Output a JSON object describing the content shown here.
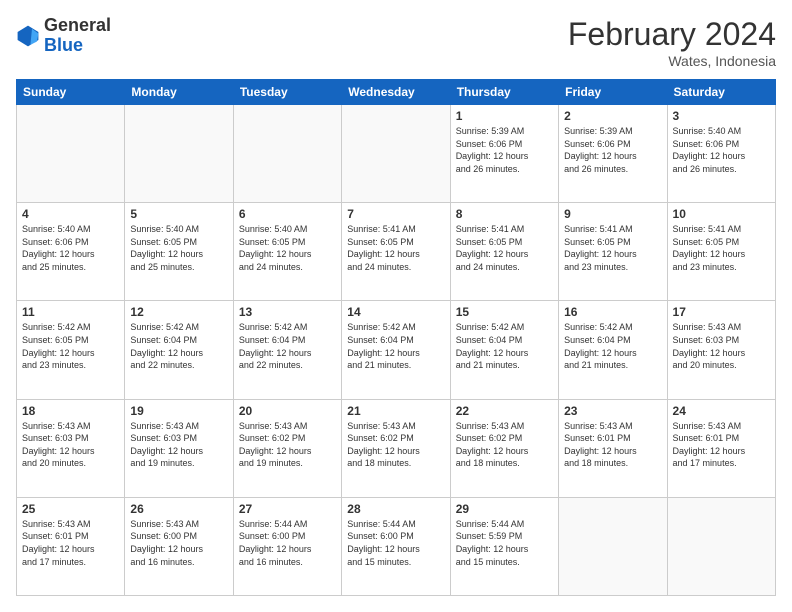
{
  "header": {
    "logo_general": "General",
    "logo_blue": "Blue",
    "month_title": "February 2024",
    "location": "Wates, Indonesia"
  },
  "days_of_week": [
    "Sunday",
    "Monday",
    "Tuesday",
    "Wednesday",
    "Thursday",
    "Friday",
    "Saturday"
  ],
  "weeks": [
    [
      {
        "day": "",
        "info": ""
      },
      {
        "day": "",
        "info": ""
      },
      {
        "day": "",
        "info": ""
      },
      {
        "day": "",
        "info": ""
      },
      {
        "day": "1",
        "info": "Sunrise: 5:39 AM\nSunset: 6:06 PM\nDaylight: 12 hours\nand 26 minutes."
      },
      {
        "day": "2",
        "info": "Sunrise: 5:39 AM\nSunset: 6:06 PM\nDaylight: 12 hours\nand 26 minutes."
      },
      {
        "day": "3",
        "info": "Sunrise: 5:40 AM\nSunset: 6:06 PM\nDaylight: 12 hours\nand 26 minutes."
      }
    ],
    [
      {
        "day": "4",
        "info": "Sunrise: 5:40 AM\nSunset: 6:06 PM\nDaylight: 12 hours\nand 25 minutes."
      },
      {
        "day": "5",
        "info": "Sunrise: 5:40 AM\nSunset: 6:05 PM\nDaylight: 12 hours\nand 25 minutes."
      },
      {
        "day": "6",
        "info": "Sunrise: 5:40 AM\nSunset: 6:05 PM\nDaylight: 12 hours\nand 24 minutes."
      },
      {
        "day": "7",
        "info": "Sunrise: 5:41 AM\nSunset: 6:05 PM\nDaylight: 12 hours\nand 24 minutes."
      },
      {
        "day": "8",
        "info": "Sunrise: 5:41 AM\nSunset: 6:05 PM\nDaylight: 12 hours\nand 24 minutes."
      },
      {
        "day": "9",
        "info": "Sunrise: 5:41 AM\nSunset: 6:05 PM\nDaylight: 12 hours\nand 23 minutes."
      },
      {
        "day": "10",
        "info": "Sunrise: 5:41 AM\nSunset: 6:05 PM\nDaylight: 12 hours\nand 23 minutes."
      }
    ],
    [
      {
        "day": "11",
        "info": "Sunrise: 5:42 AM\nSunset: 6:05 PM\nDaylight: 12 hours\nand 23 minutes."
      },
      {
        "day": "12",
        "info": "Sunrise: 5:42 AM\nSunset: 6:04 PM\nDaylight: 12 hours\nand 22 minutes."
      },
      {
        "day": "13",
        "info": "Sunrise: 5:42 AM\nSunset: 6:04 PM\nDaylight: 12 hours\nand 22 minutes."
      },
      {
        "day": "14",
        "info": "Sunrise: 5:42 AM\nSunset: 6:04 PM\nDaylight: 12 hours\nand 21 minutes."
      },
      {
        "day": "15",
        "info": "Sunrise: 5:42 AM\nSunset: 6:04 PM\nDaylight: 12 hours\nand 21 minutes."
      },
      {
        "day": "16",
        "info": "Sunrise: 5:42 AM\nSunset: 6:04 PM\nDaylight: 12 hours\nand 21 minutes."
      },
      {
        "day": "17",
        "info": "Sunrise: 5:43 AM\nSunset: 6:03 PM\nDaylight: 12 hours\nand 20 minutes."
      }
    ],
    [
      {
        "day": "18",
        "info": "Sunrise: 5:43 AM\nSunset: 6:03 PM\nDaylight: 12 hours\nand 20 minutes."
      },
      {
        "day": "19",
        "info": "Sunrise: 5:43 AM\nSunset: 6:03 PM\nDaylight: 12 hours\nand 19 minutes."
      },
      {
        "day": "20",
        "info": "Sunrise: 5:43 AM\nSunset: 6:02 PM\nDaylight: 12 hours\nand 19 minutes."
      },
      {
        "day": "21",
        "info": "Sunrise: 5:43 AM\nSunset: 6:02 PM\nDaylight: 12 hours\nand 18 minutes."
      },
      {
        "day": "22",
        "info": "Sunrise: 5:43 AM\nSunset: 6:02 PM\nDaylight: 12 hours\nand 18 minutes."
      },
      {
        "day": "23",
        "info": "Sunrise: 5:43 AM\nSunset: 6:01 PM\nDaylight: 12 hours\nand 18 minutes."
      },
      {
        "day": "24",
        "info": "Sunrise: 5:43 AM\nSunset: 6:01 PM\nDaylight: 12 hours\nand 17 minutes."
      }
    ],
    [
      {
        "day": "25",
        "info": "Sunrise: 5:43 AM\nSunset: 6:01 PM\nDaylight: 12 hours\nand 17 minutes."
      },
      {
        "day": "26",
        "info": "Sunrise: 5:43 AM\nSunset: 6:00 PM\nDaylight: 12 hours\nand 16 minutes."
      },
      {
        "day": "27",
        "info": "Sunrise: 5:44 AM\nSunset: 6:00 PM\nDaylight: 12 hours\nand 16 minutes."
      },
      {
        "day": "28",
        "info": "Sunrise: 5:44 AM\nSunset: 6:00 PM\nDaylight: 12 hours\nand 15 minutes."
      },
      {
        "day": "29",
        "info": "Sunrise: 5:44 AM\nSunset: 5:59 PM\nDaylight: 12 hours\nand 15 minutes."
      },
      {
        "day": "",
        "info": ""
      },
      {
        "day": "",
        "info": ""
      }
    ]
  ]
}
